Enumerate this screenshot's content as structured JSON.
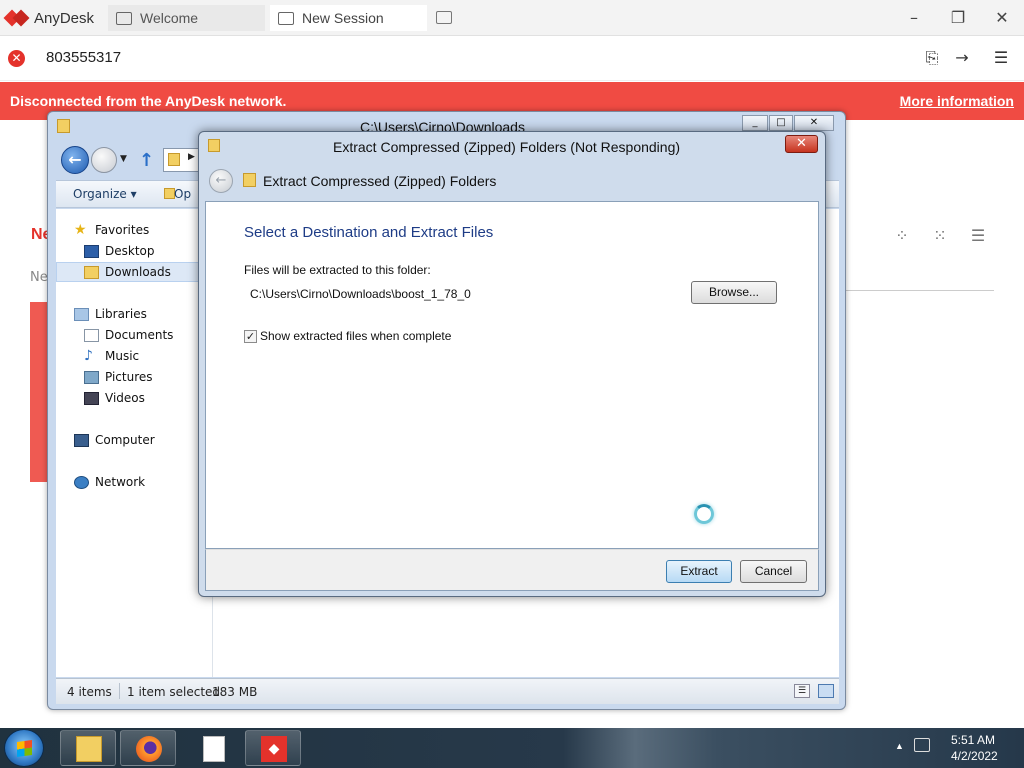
{
  "anydesk": {
    "app_name": "AnyDesk",
    "tabs": [
      {
        "label": "Welcome"
      },
      {
        "label": "New Session"
      }
    ],
    "address": "803555317",
    "banner": {
      "message": "Disconnected from the AnyDesk network.",
      "link": "More information"
    },
    "window_controls": {
      "minimize": "–",
      "restore": "❐",
      "close": "✕"
    },
    "background_title": "Ne",
    "background_sub": "Ne",
    "brand_color": "#e4322b",
    "banner_color": "#f04b43"
  },
  "explorer": {
    "title": "C:\\Users\\Cirno\\Downloads",
    "toolbar": {
      "organize": "Organize ▾",
      "open": "Op"
    },
    "nav": {
      "favorites": "Favorites",
      "desktop": "Desktop",
      "downloads": "Downloads",
      "libraries": "Libraries",
      "documents": "Documents",
      "music": "Music",
      "pictures": "Pictures",
      "videos": "Videos",
      "computer": "Computer",
      "network": "Network"
    },
    "status": {
      "items": "4 items",
      "selected": "1 item selected",
      "size": "183 MB"
    }
  },
  "dialog": {
    "title": "Extract Compressed (Zipped) Folders (Not Responding)",
    "header": "Extract Compressed (Zipped) Folders",
    "heading": "Select a Destination and Extract Files",
    "folder_label": "Files will be extracted to this folder:",
    "folder_path": "C:\\Users\\Cirno\\Downloads\\boost_1_78_0",
    "browse": "Browse...",
    "show_files_label": "Show extracted files when complete",
    "show_files_checked": true,
    "extract": "Extract",
    "cancel": "Cancel",
    "close": "✕"
  },
  "taskbar": {
    "time": "5:51 AM",
    "date": "4/2/2022",
    "apps": [
      "windows-explorer",
      "firefox",
      "notepad",
      "anydesk"
    ]
  }
}
